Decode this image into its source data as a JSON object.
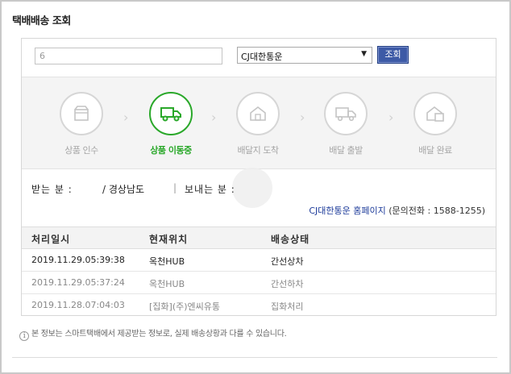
{
  "title": "택배배송 조회",
  "query": {
    "invoice_value": "6",
    "carrier_selected": "CJ대한통운",
    "search_button": "조회"
  },
  "steps": [
    {
      "label": "상품 인수",
      "icon": "box-icon",
      "state": "inactive"
    },
    {
      "label": "상품 이동중",
      "icon": "truck-icon",
      "state": "active"
    },
    {
      "label": "배달지 도착",
      "icon": "house-icon",
      "state": "inactive"
    },
    {
      "label": "배달 출발",
      "icon": "delivery-truck-icon",
      "state": "inactive"
    },
    {
      "label": "배달 완료",
      "icon": "house-box-icon",
      "state": "inactive"
    }
  ],
  "info": {
    "receiver_label": "받는 분 :",
    "receiver_value": "/ 경상남도",
    "sender_label": "보내는 분 :",
    "homepage_link": "CJ대한통운 홈페이지",
    "phone_text": "(문의전화 : 1588-1255)"
  },
  "table": {
    "headers": [
      "처리일시",
      "현재위치",
      "배송상태"
    ],
    "rows": [
      {
        "datetime": "2019.11.29.05:39:38",
        "location": "옥천HUB",
        "status": "간선상차"
      },
      {
        "datetime": "2019.11.29.05:37:24",
        "location": "옥천HUB",
        "status": "간선하차"
      },
      {
        "datetime": "2019.11.28.07:04:03",
        "location": "[집화](주)엔씨유통",
        "status": "집화처리"
      }
    ]
  },
  "notice": "본 정보는 스마트택배에서 제공받는 정보로, 실제 배송상황과 다를 수 있습니다.",
  "colors": {
    "active_green": "#2aa82a",
    "button_blue": "#3d5aa6",
    "link_blue": "#1d3b9a"
  }
}
